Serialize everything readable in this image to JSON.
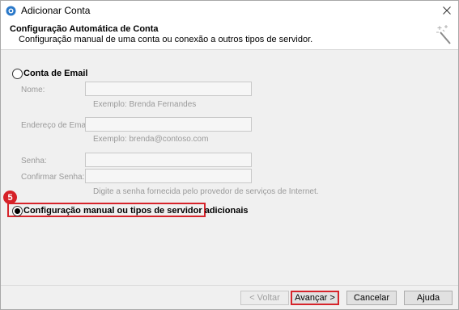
{
  "window": {
    "title": "Adicionar Conta"
  },
  "header": {
    "title": "Configuração Automática de Conta",
    "subtitle": "Configuração manual de uma conta ou conexão a outros tipos de servidor."
  },
  "email_account": {
    "radio_label": "Conta de Email",
    "name_label": "Nome:",
    "name_value": "",
    "name_hint": "Exemplo: Brenda Fernandes",
    "email_label": "Endereço de Email:",
    "email_value": "",
    "email_hint": "Exemplo: brenda@contoso.com",
    "password_label": "Senha:",
    "password_value": "",
    "confirm_label": "Confirmar Senha:",
    "confirm_value": "",
    "password_hint": "Digite a senha fornecida pelo provedor de serviços de Internet."
  },
  "manual_setup": {
    "radio_label": "Configuração manual ou tipos de servidor adicionais",
    "selected": true
  },
  "annotation": {
    "step_number": "5",
    "color": "#d6242b"
  },
  "footer": {
    "back_label": "< Voltar",
    "next_label": "Avançar >",
    "cancel_label": "Cancelar",
    "help_label": "Ajuda"
  }
}
